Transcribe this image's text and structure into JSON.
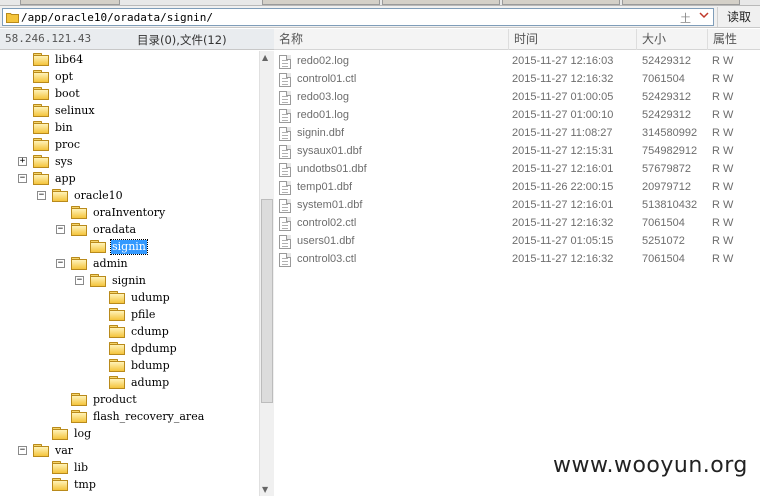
{
  "address": {
    "path": "/app/oracle10/oradata/signin/",
    "hint": "土",
    "read_label": "读取"
  },
  "left_header": {
    "ip": "58.246.121.43",
    "count": "目录(0),文件(12)"
  },
  "tree": [
    {
      "label": "lib64",
      "depth": 1,
      "expander": ""
    },
    {
      "label": "opt",
      "depth": 1,
      "expander": ""
    },
    {
      "label": "boot",
      "depth": 1,
      "expander": ""
    },
    {
      "label": "selinux",
      "depth": 1,
      "expander": ""
    },
    {
      "label": "bin",
      "depth": 1,
      "expander": ""
    },
    {
      "label": "proc",
      "depth": 1,
      "expander": ""
    },
    {
      "label": "sys",
      "depth": 1,
      "expander": "+"
    },
    {
      "label": "app",
      "depth": 1,
      "expander": "-"
    },
    {
      "label": "oracle10",
      "depth": 2,
      "expander": "-"
    },
    {
      "label": "oraInventory",
      "depth": 3,
      "expander": ""
    },
    {
      "label": "oradata",
      "depth": 3,
      "expander": "-"
    },
    {
      "label": "signin",
      "depth": 4,
      "expander": "",
      "selected": true
    },
    {
      "label": "admin",
      "depth": 3,
      "expander": "-"
    },
    {
      "label": "signin",
      "depth": 4,
      "expander": "-"
    },
    {
      "label": "udump",
      "depth": 5,
      "expander": ""
    },
    {
      "label": "pfile",
      "depth": 5,
      "expander": ""
    },
    {
      "label": "cdump",
      "depth": 5,
      "expander": ""
    },
    {
      "label": "dpdump",
      "depth": 5,
      "expander": ""
    },
    {
      "label": "bdump",
      "depth": 5,
      "expander": ""
    },
    {
      "label": "adump",
      "depth": 5,
      "expander": ""
    },
    {
      "label": "product",
      "depth": 3,
      "expander": ""
    },
    {
      "label": "flash_recovery_area",
      "depth": 3,
      "expander": ""
    },
    {
      "label": "log",
      "depth": 2,
      "expander": ""
    },
    {
      "label": "var",
      "depth": 1,
      "expander": "-"
    },
    {
      "label": "lib",
      "depth": 2,
      "expander": ""
    },
    {
      "label": "tmp",
      "depth": 2,
      "expander": ""
    }
  ],
  "columns": {
    "name": "名称",
    "time": "时间",
    "size": "大小",
    "attr": "属性"
  },
  "files": [
    {
      "name": "redo02.log",
      "time": "2015-11-27 12:16:03",
      "size": "52429312",
      "attr": "R W"
    },
    {
      "name": "control01.ctl",
      "time": "2015-11-27 12:16:32",
      "size": "7061504",
      "attr": "R W"
    },
    {
      "name": "redo03.log",
      "time": "2015-11-27 01:00:05",
      "size": "52429312",
      "attr": "R W"
    },
    {
      "name": "redo01.log",
      "time": "2015-11-27 01:00:10",
      "size": "52429312",
      "attr": "R W"
    },
    {
      "name": "signin.dbf",
      "time": "2015-11-27 11:08:27",
      "size": "314580992",
      "attr": "R W"
    },
    {
      "name": "sysaux01.dbf",
      "time": "2015-11-27 12:15:31",
      "size": "754982912",
      "attr": "R W"
    },
    {
      "name": "undotbs01.dbf",
      "time": "2015-11-27 12:16:01",
      "size": "57679872",
      "attr": "R W"
    },
    {
      "name": "temp01.dbf",
      "time": "2015-11-26 22:00:15",
      "size": "20979712",
      "attr": "R W"
    },
    {
      "name": "system01.dbf",
      "time": "2015-11-27 12:16:01",
      "size": "513810432",
      "attr": "R W"
    },
    {
      "name": "control02.ctl",
      "time": "2015-11-27 12:16:32",
      "size": "7061504",
      "attr": "R W"
    },
    {
      "name": "users01.dbf",
      "time": "2015-11-27 01:05:15",
      "size": "5251072",
      "attr": "R W"
    },
    {
      "name": "control03.ctl",
      "time": "2015-11-27 12:16:32",
      "size": "7061504",
      "attr": "R W"
    }
  ],
  "watermark": "www.wooyun.org"
}
